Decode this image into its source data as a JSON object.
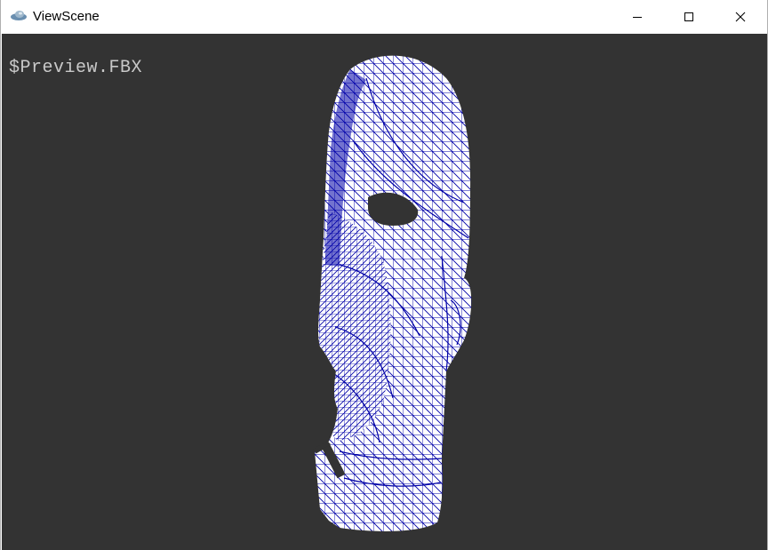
{
  "window": {
    "title": "ViewScene",
    "icon": "viewscene-app-icon",
    "controls": [
      "minimize-icon",
      "maximize-icon",
      "close-icon"
    ]
  },
  "viewport": {
    "file_label": "$Preview.FBX",
    "background_color": "#333333",
    "mesh_fill_color": "#ffffff",
    "wireframe_color": "#0000a8",
    "model": "wireframe-head-mesh"
  }
}
